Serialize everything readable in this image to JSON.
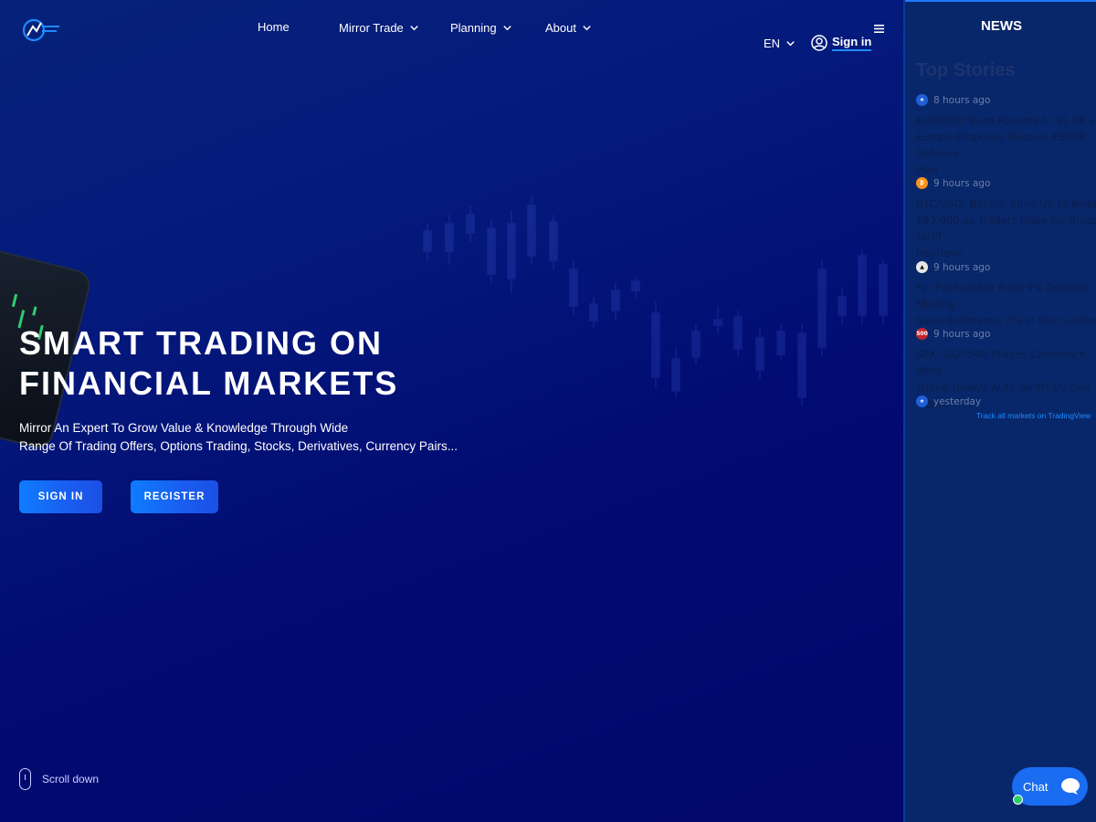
{
  "nav": {
    "home": "Home",
    "mirror_trade": "Mirror Trade",
    "planning": "Planning",
    "about": "About",
    "language": "EN",
    "sign_in": "Sign in"
  },
  "hero": {
    "headline_line1": "SMART TRADING ON",
    "headline_line2": "FINANCIAL MARKETS",
    "subtitle_line1": "Mirror An Expert To Grow Value & Knowledge Through Wide",
    "subtitle_line2": "Range Of Trading Offers, Options Trading, Stocks, Derivatives, Currency Pairs...",
    "signin_button": "SIGN IN",
    "register_button": "REGISTER",
    "scroll_label": "Scroll down"
  },
  "news": {
    "panel_title": "NEWS",
    "section_title": "Top Stories",
    "stories": [
      {
        "time": "8 hours ago",
        "text": "EUR/USD: Euro Rockets to $1.08 as\nEurope Proposes Massive €800B Defense\nPlan",
        "icon": "eu-flag-icon",
        "color": "#1f5fd6"
      },
      {
        "time": "9 hours ago",
        "text": "BTC/USD: Bitcoin Turns Up to Regain\n$93,000 as Traders Hope for Broad Tariff\nReprieve",
        "icon": "bitcoin-icon",
        "color": "#f7931a"
      },
      {
        "time": "9 hours ago",
        "text": "FL: Foot Locker Pops 5% Despite Missing\nSales Estimates. It’s in the Guidance.",
        "icon": "footlocker-icon",
        "color": "#e6e6e6"
      },
      {
        "time": "9 hours ago",
        "text": "SPX: S&P 500 Stages Comeback After\nTrump Delays Auto Tariffs by One Month",
        "icon": "sp500-icon",
        "color": "#c0262d"
      },
      {
        "time": "yesterday",
        "text": "",
        "icon": "eu-flag-icon",
        "color": "#1f5fd6"
      }
    ],
    "track_link": "Track all markets on TradingView"
  },
  "chat": {
    "label": "Chat"
  },
  "colors": {
    "accent": "#1e8bff",
    "background": "#020a6e",
    "panel": "#08276a"
  }
}
